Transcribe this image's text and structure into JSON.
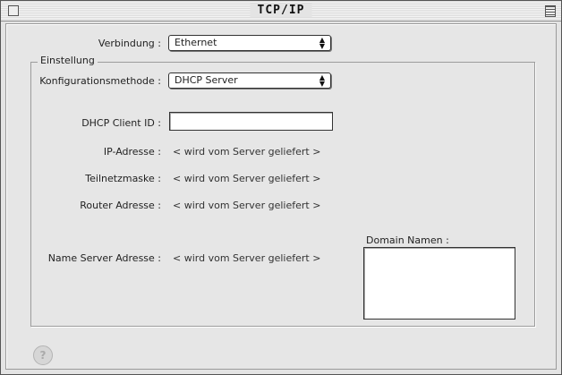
{
  "window": {
    "title": "TCP/IP"
  },
  "connection": {
    "label": "Verbindung :",
    "selected": "Ethernet"
  },
  "settings_group": {
    "label": "Einstellung"
  },
  "config_method": {
    "label": "Konfigurationsmethode :",
    "selected": "DHCP Server"
  },
  "dhcp_client_id": {
    "label": "DHCP Client ID :",
    "value": ""
  },
  "ip_address": {
    "label": "IP-Adresse :",
    "value": "< wird vom Server geliefert >"
  },
  "subnet_mask": {
    "label": "Teilnetzmaske :",
    "value": "< wird vom Server geliefert >"
  },
  "router_address": {
    "label": "Router Adresse :",
    "value": "< wird vom Server geliefert >"
  },
  "name_server": {
    "label": "Name Server Adresse :",
    "value": "< wird vom Server geliefert >"
  },
  "domain_names": {
    "label": "Domain Namen :",
    "value": ""
  },
  "icons": {
    "close": "close-box-icon",
    "zoom": "zoom-box-icon",
    "help": "help-icon",
    "popup_arrow": "up-down-arrow-icon"
  }
}
